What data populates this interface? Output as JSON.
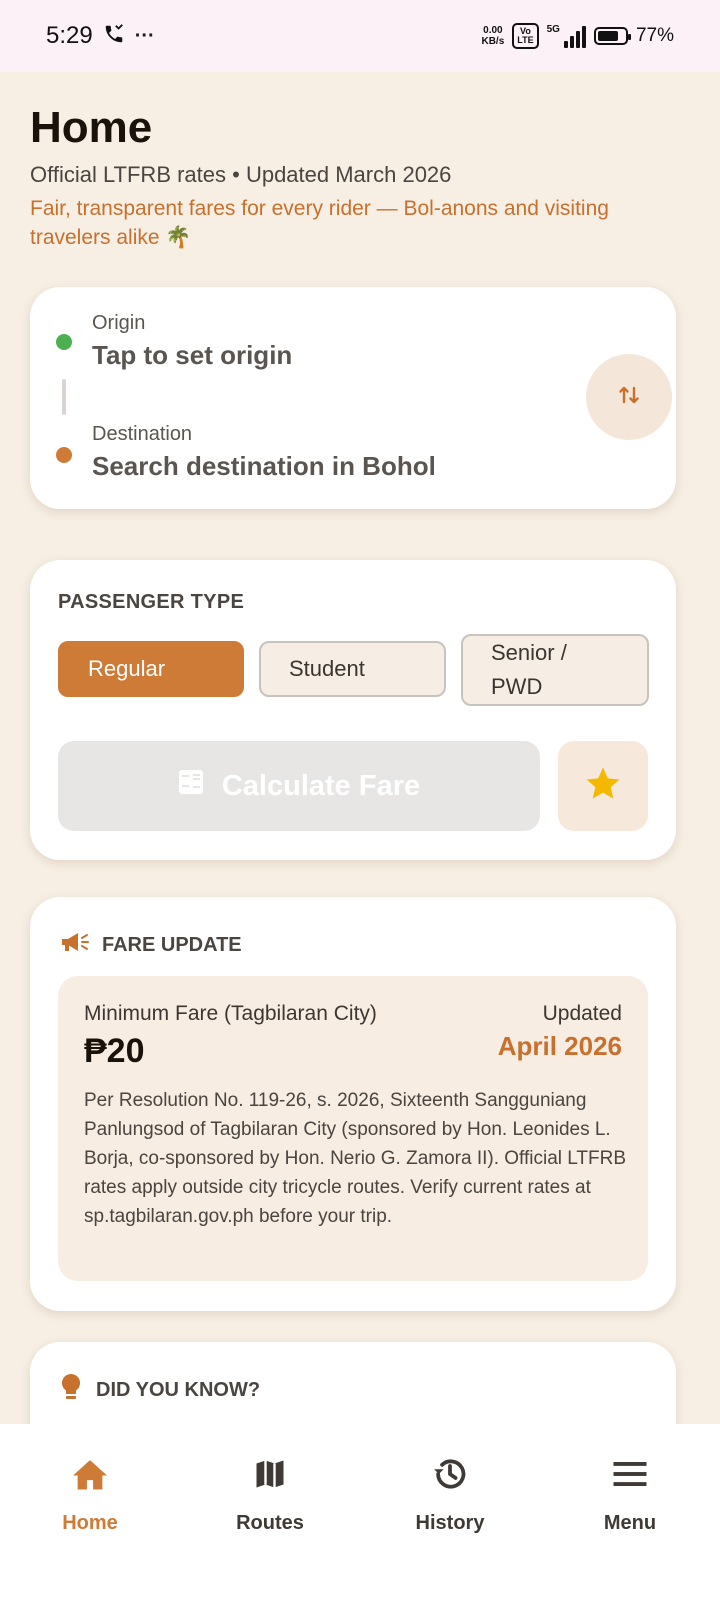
{
  "status_bar": {
    "time": "5:29",
    "more": "···",
    "net_speed_value": "0.00",
    "net_speed_unit": "KB/s",
    "volte_top": "Vo",
    "volte_bottom": "LTE",
    "network": "5G",
    "battery_percent": "77%",
    "battery_level": 0.77
  },
  "header": {
    "title": "Home",
    "subtitle": "Official LTFRB rates • Updated March 2026",
    "tagline": "Fair, transparent fares for every rider — Bol-anons and visiting travelers alike 🌴"
  },
  "route": {
    "origin_label": "Origin",
    "origin_value": "Tap to set origin",
    "destination_label": "Destination",
    "destination_value": "Search destination in Bohol"
  },
  "passenger": {
    "heading": "PASSENGER TYPE",
    "types": [
      "Regular",
      "Student",
      "Senior / PWD"
    ],
    "selected": "Regular",
    "calculate_label": "Calculate Fare"
  },
  "fare_update": {
    "heading": "FARE UPDATE",
    "minimum_label": "Minimum Fare (Tagbilaran City)",
    "minimum_value": "₱20",
    "updated_label": "Updated",
    "updated_value": "April 2026",
    "note": "Per Resolution No. 119-26, s. 2026, Sixteenth Sangguniang Panlungsod of Tagbilaran City (sponsored by Hon. Leonides L. Borja, co-sponsored by Hon. Nerio G. Zamora II). Official LTFRB rates apply outside city tricycle routes. Verify current rates at sp.tagbilaran.gov.ph before your trip."
  },
  "did_you_know": {
    "heading": "DID YOU KNOW?"
  },
  "bottom_nav": {
    "items": [
      {
        "label": "Home",
        "icon": "home-icon"
      },
      {
        "label": "Routes",
        "icon": "map-icon"
      },
      {
        "label": "History",
        "icon": "history-icon"
      },
      {
        "label": "Menu",
        "icon": "menu-icon"
      }
    ],
    "active": "Home"
  },
  "colors": {
    "accent": "#cf7b38",
    "background": "#f7efe4",
    "origin_dot": "#4caf50",
    "star": "#f5b800"
  }
}
